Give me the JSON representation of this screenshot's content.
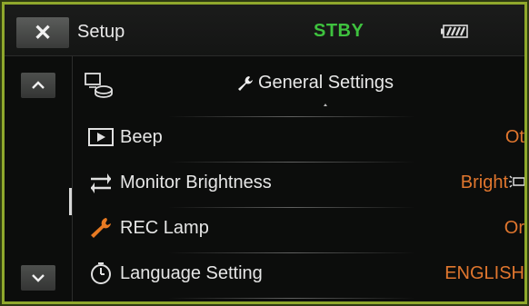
{
  "header": {
    "close_label": "✕",
    "title": "Setup",
    "status": "STBY",
    "status_color": "#3ec23e",
    "battery_icon": "battery-icon"
  },
  "section": {
    "title": "General Settings",
    "icon": "wrench-icon"
  },
  "rows": [
    {
      "label": "Beep",
      "value": "Ot",
      "icon": "play-box-icon"
    },
    {
      "label": "Monitor Brightness",
      "value": "Bright",
      "icon": "swap-arrows-icon"
    },
    {
      "label": "REC Lamp",
      "value": "Or",
      "icon": "wrench-icon"
    },
    {
      "label": "Language Setting",
      "value": "ENGLISH",
      "icon": "timer-icon"
    }
  ],
  "colors": {
    "accent_border": "#8fa82c",
    "value_text": "#e0762e"
  }
}
